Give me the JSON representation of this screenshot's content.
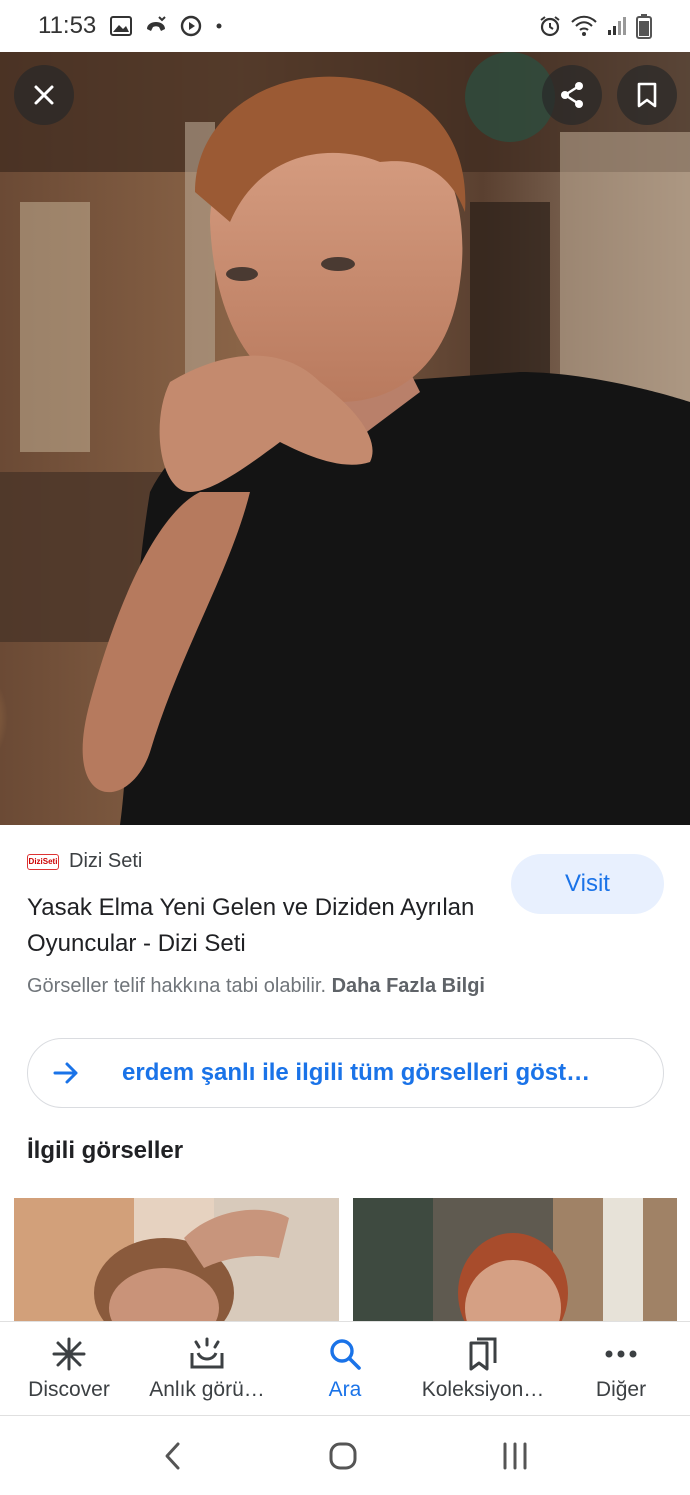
{
  "status_bar": {
    "time": "11:53",
    "left_icons": [
      "image-icon",
      "missed-call-icon",
      "media-icon",
      "dot-icon"
    ],
    "right_icons": [
      "alarm-icon",
      "wifi-icon",
      "signal-icon",
      "battery-icon"
    ]
  },
  "hero": {
    "close_icon": "close-icon",
    "share_icon": "share-icon",
    "bookmark_icon": "bookmark-icon"
  },
  "result": {
    "source_logo_text": "DiziSeti",
    "source_name": "Dizi Seti",
    "title": "Yasak Elma Yeni Gelen ve Diziden Ayrılan Oyuncular - Dizi Seti",
    "visit_label": "Visit",
    "copyright_text": "Görseller telif hakkına tabi olabilir.",
    "more_info_label": "Daha Fazla Bilgi"
  },
  "show_all": {
    "label": "erdem şanlı ile ilgili tüm görselleri göst…"
  },
  "related": {
    "heading": "İlgili görseller"
  },
  "bottom_nav": {
    "items": [
      {
        "label": "Discover",
        "icon": "discover-icon",
        "active": false
      },
      {
        "label": "Anlık görü…",
        "icon": "snapshot-icon",
        "active": false
      },
      {
        "label": "Ara",
        "icon": "search-icon",
        "active": true
      },
      {
        "label": "Koleksiyon…",
        "icon": "collections-icon",
        "active": false
      },
      {
        "label": "Diğer",
        "icon": "more-icon",
        "active": false
      }
    ]
  },
  "colors": {
    "accent": "#1a73e8",
    "visit_bg": "#e8f0fe",
    "text_primary": "#202124",
    "text_secondary": "#70757a"
  }
}
